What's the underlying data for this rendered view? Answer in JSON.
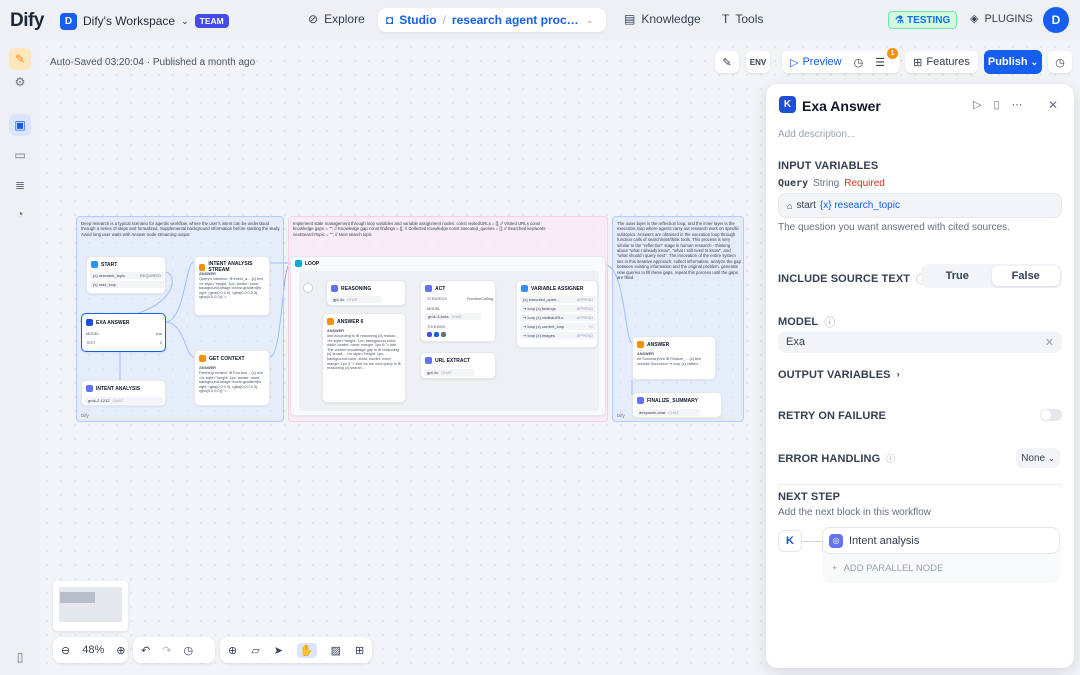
{
  "header": {
    "logo": "Dify",
    "workspace_initial": "D",
    "workspace_name": "Dify's Workspace",
    "team_badge": "TEAM",
    "nav": {
      "explore": "Explore",
      "studio": "Studio",
      "app_name": "research agent process ...",
      "knowledge": "Knowledge",
      "tools": "Tools"
    },
    "testing_badge": "TESTING",
    "plugins": "PLUGINS",
    "user_initial": "D"
  },
  "toolbar": {
    "autosave": "Auto-Saved 03:20:04 · Published a month ago",
    "preview": "Preview",
    "checklist_count": "1",
    "features": "Features",
    "publish": "Publish"
  },
  "canvas": {
    "groups": [
      {
        "text": "Deep research is a typical scenario for agentic workflow, where the user's intent can be understood through a series of steps and formalized. Supplemental background information before starting the study. Avoid long user waits with Answer node streaming output",
        "footer": "Dify"
      },
      {
        "text": "Implement state management through loop variables and variable assignment nodes: const visitedURLs = []; // Visited URLs const knowledge gaps = \"\"; // Knowledge gap const findings = []; // Collected knowledge const executed_queries = []; // Searched keywords nextSearchTopic = \"\"; // Next search topic"
      },
      {
        "text": "The outer layer is the reflection loop, and the inner layer is the execution loop where agents carry out research work on specific subtopics. Answers are obtained in the execution loop through function calls of search/visit/think tools. This process is very similar to the \"reflection\" stage in human research - thinking about \"what I already know\", \"what I still need to know\", and \"what should I query next\". The innovation of the entire system lies in this iterative approach: collect information, analyze the gap between existing information and the original problem, generate new queries to fill these gaps, repeat this process until the gaps are filled.",
        "footer": "Dify"
      }
    ],
    "nodes": {
      "start": {
        "title": "START",
        "vars": [
          "{x} research_topic",
          "{x} max_loop"
        ],
        "req": "REQUIRED"
      },
      "exa": {
        "title": "EXA ANSWER",
        "model_label": "MODEL",
        "model_value": "exa",
        "text_label": "TEXT",
        "text_value": "0"
      },
      "intent": {
        "title": "INTENT ANALYSIS",
        "model": "grok-2-1212",
        "tag": "CHAT"
      },
      "intent_stream": {
        "title": "INTENT ANALYSIS STREAM",
        "label": "ANSWER",
        "body": "Query's intention: ⊕ intent_a... {x} text <tr style=\"height: 1px; border: none; background-image: linear-gradient(to right, rgba(0,0,0,0), rgba(0,0,0,0.3), rgba(0,0,0,0));\">"
      },
      "context": {
        "title": "GET CONTEXT",
        "label": "ANSWER",
        "body": "Fetching context: ⊕ Exa Ans... {x} text <hr style=\"height: 1px; border: none; background-image: linear-gradient(to right, rgba(0,0,0,0), rgba(0,0,0,0.3), rgba(0,0,0,0));\">"
      },
      "loop": {
        "title": "LOOP"
      },
      "reasoning": {
        "title": "REASONING",
        "model": "gpt-4o",
        "tag": "CHAT"
      },
      "answer6": {
        "title": "ANSWER 6",
        "label": "ANSWER",
        "body": "### according to ⊕ reasoning {x} reason... <hr style=\"height: 1px; background-color: #ddd; border: none; margin: 1px 0;\"> ### The current knowledge gap is ⊕ reasoning {x} knowl... <hr style=\"height: 1px; background-color: #ddd; border: none; margin: 1px 0;\"> ### So the next query is ⊕ reasoning {x} search..."
      },
      "act": {
        "title": "ACT",
        "strategy_label": "STRATEGY",
        "strategy": "FunctionCalling",
        "model_label": "MODEL",
        "model": "grok-3-beta",
        "tag": "CHAT",
        "toolbox": "TOOLBOX"
      },
      "url_extract": {
        "title": "URL EXTRACT",
        "model": "gpt-4o",
        "tag": "CHAT"
      },
      "assigner": {
        "title": "VARIABLE ASSIGNER",
        "rows": [
          "{x} executed_queri...",
          "⇝ loop {x} findings",
          "⇝ loop {x} visitedURLs",
          "⇝ loop {x} current_loop",
          "⇝ loop {x} images"
        ],
        "tags": [
          "APPEND",
          "APPEND",
          "APPEND",
          "+=",
          "APPEND"
        ]
      },
      "final_answer": {
        "title": "ANSWER",
        "label": "ANSWER",
        "body": "## Summary\\n\\n ⊕ Finalize_... {x} text \\n\\n### Sources\\n ⇝ loop {x} visited..."
      },
      "finalize": {
        "title": "FINALIZE_SUMMARY",
        "model": "deepseek-chat",
        "tag": "CHAT"
      }
    },
    "zoom": "48%"
  },
  "panel": {
    "title": "Exa Answer",
    "description_placeholder": "Add description...",
    "input_variables": "INPUT VARIABLES",
    "query_label": "Query",
    "query_type": "String",
    "query_required": "Required",
    "query_source": "start",
    "query_var": "{x} research_topic",
    "query_help": "The question you want answered with cited sources.",
    "include_source": "INCLUDE SOURCE TEXT",
    "true_label": "True",
    "false_label": "False",
    "model_label": "MODEL",
    "model_value": "Exa",
    "output_variables": "OUTPUT VARIABLES",
    "retry": "RETRY ON FAILURE",
    "error_handling": "ERROR HANDLING",
    "error_value": "None",
    "next_step": "NEXT STEP",
    "next_step_help": "Add the next block in this workflow",
    "next_node": "Intent analysis",
    "add_parallel": "ADD PARALLEL NODE"
  },
  "colors": {
    "accent": "#155eef",
    "start": "#2e90fa",
    "llm": "#6172f3",
    "answer": "#f79009",
    "loop": "#06aed4",
    "assigner": "#2e90fa",
    "required": "#d92d20"
  }
}
